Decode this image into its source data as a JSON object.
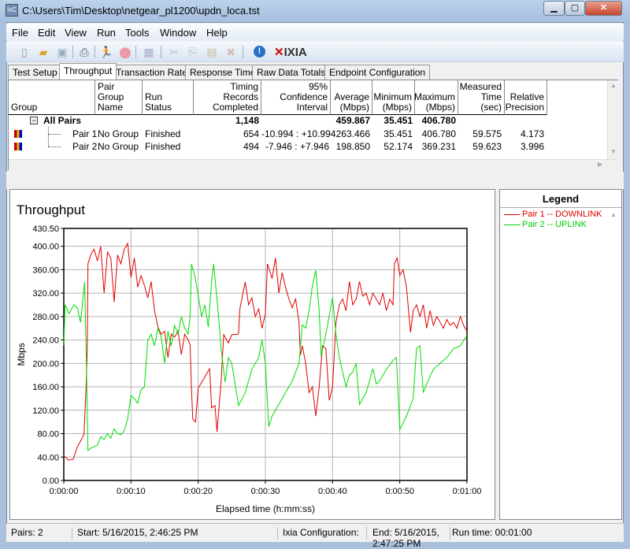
{
  "window": {
    "title": "C:\\Users\\Tim\\Desktop\\netgear_pl1200\\updn_loca.tst",
    "app_icon": "ixchariot-icon",
    "minimize": "minimize-icon",
    "maximize": "maximize-icon",
    "close": "close-icon"
  },
  "menu": [
    "File",
    "Edit",
    "View",
    "Run",
    "Tools",
    "Window",
    "Help"
  ],
  "toolbar": {
    "icons": [
      "new-file-icon",
      "open-folder-icon",
      "save-icon",
      "print-icon",
      "run-icon",
      "stop-icon",
      "refresh-icon",
      "cut-icon",
      "copy-icon",
      "paste-icon",
      "delete-icon",
      "info-icon"
    ],
    "brand": "IXIA"
  },
  "tabs": [
    "Test Setup",
    "Throughput",
    "Transaction Rate",
    "Response Time",
    "Raw Data Totals",
    "Endpoint Configuration"
  ],
  "active_tab": "Throughput",
  "table": {
    "headers": [
      "Group",
      "Pair Group Name",
      "Run Status",
      "Timing Records Completed",
      "95% Confidence Interval",
      "Average (Mbps)",
      "Minimum (Mbps)",
      "Maximum (Mbps)",
      "Measured Time (sec)",
      "Relative Precision"
    ],
    "summary": {
      "label": "All Pairs",
      "records": "1,148",
      "average": "459.867",
      "minimum": "35.451",
      "maximum": "406.780"
    },
    "rows": [
      {
        "pair": "Pair 1",
        "group": "No Group",
        "status": "Finished",
        "records": "654",
        "ci": "-10.994 : +10.994",
        "average": "263.466",
        "minimum": "35.451",
        "maximum": "406.780",
        "time": "59.575",
        "precision": "4.173"
      },
      {
        "pair": "Pair 2",
        "group": "No Group",
        "status": "Finished",
        "records": "494",
        "ci": "-7.946 : +7.946",
        "average": "198.850",
        "minimum": "52.174",
        "maximum": "369.231",
        "time": "59.623",
        "precision": "3.996"
      }
    ]
  },
  "legend": {
    "title": "Legend",
    "items": [
      "Pair 1 -- DOWNLINK",
      "Pair 2 -- UPLINK"
    ]
  },
  "status": {
    "pairs": "Pairs: 2",
    "start": "Start: 5/16/2015, 2:46:25 PM",
    "config": "Ixia Configuration:",
    "end": "End: 5/16/2015, 2:47:25 PM",
    "runtime": "Run time: 00:01:00"
  },
  "chart_data": {
    "type": "line",
    "title": "Throughput",
    "xlabel": "Elapsed time (h:mm:ss)",
    "ylabel": "Mbps",
    "ylim": [
      0,
      430.5
    ],
    "xlim": [
      0,
      60
    ],
    "grid": true,
    "legend_placement": "right-panel",
    "yticks": [
      "0.00",
      "40.00",
      "80.00",
      "120.00",
      "160.00",
      "200.00",
      "240.00",
      "280.00",
      "320.00",
      "360.00",
      "400.00",
      "430.50"
    ],
    "ytick_values": [
      0,
      40,
      80,
      120,
      160,
      200,
      240,
      280,
      320,
      360,
      400,
      430.5
    ],
    "xticks": [
      "0:00:00",
      "0:00:10",
      "0:00:20",
      "0:00:30",
      "0:00:40",
      "0:00:50",
      "0:01:00"
    ],
    "xtick_values": [
      0,
      10,
      20,
      30,
      40,
      50,
      60
    ],
    "series": [
      {
        "name": "Pair 1 -- DOWNLINK",
        "color": "#e00000",
        "points": [
          [
            0,
            42
          ],
          [
            0.7,
            35
          ],
          [
            1.4,
            36
          ],
          [
            2,
            57
          ],
          [
            3,
            78
          ],
          [
            3.3,
            155
          ],
          [
            3.5,
            231
          ],
          [
            3.6,
            370
          ],
          [
            4,
            385
          ],
          [
            4.5,
            395
          ],
          [
            5,
            375
          ],
          [
            5.5,
            400
          ],
          [
            6,
            320
          ],
          [
            6.5,
            390
          ],
          [
            7,
            380
          ],
          [
            7.5,
            305
          ],
          [
            8,
            385
          ],
          [
            8.5,
            370
          ],
          [
            9,
            395
          ],
          [
            9.5,
            405
          ],
          [
            10,
            347
          ],
          [
            10.5,
            380
          ],
          [
            11,
            330
          ],
          [
            11.5,
            350
          ],
          [
            12,
            333
          ],
          [
            12.5,
            312
          ],
          [
            13,
            340
          ],
          [
            13.5,
            290
          ],
          [
            14,
            262
          ],
          [
            14.5,
            250
          ],
          [
            15,
            255
          ],
          [
            15.5,
            210
          ],
          [
            16,
            250
          ],
          [
            16.5,
            245
          ],
          [
            17,
            255
          ],
          [
            17.5,
            215
          ],
          [
            18,
            250
          ],
          [
            18.5,
            240
          ],
          [
            18.8,
            232
          ],
          [
            19,
            158
          ],
          [
            19.2,
            105
          ],
          [
            19.6,
            100
          ],
          [
            20,
            158
          ],
          [
            21,
            177
          ],
          [
            21.7,
            191
          ],
          [
            22,
            124
          ],
          [
            22.5,
            128
          ],
          [
            22.8,
            83
          ],
          [
            23.4,
            168
          ],
          [
            23.8,
            249
          ],
          [
            24.5,
            235
          ],
          [
            25,
            249
          ],
          [
            26,
            250
          ],
          [
            26.2,
            293
          ],
          [
            27,
            339
          ],
          [
            27.5,
            300
          ],
          [
            28,
            312
          ],
          [
            28.5,
            280
          ],
          [
            29,
            293
          ],
          [
            29.5,
            260
          ],
          [
            30,
            285
          ],
          [
            30.3,
            370
          ],
          [
            31,
            345
          ],
          [
            31.5,
            380
          ],
          [
            32,
            320
          ],
          [
            32.5,
            355
          ],
          [
            33,
            330
          ],
          [
            33.5,
            310
          ],
          [
            34,
            295
          ],
          [
            34.5,
            310
          ],
          [
            35,
            270
          ],
          [
            35.2,
            214
          ],
          [
            35.5,
            230
          ],
          [
            36,
            200
          ],
          [
            36.5,
            150
          ],
          [
            37,
            160
          ],
          [
            37.5,
            110
          ],
          [
            38,
            160
          ],
          [
            38.5,
            230
          ],
          [
            39,
            225
          ],
          [
            39.5,
            137
          ],
          [
            40,
            160
          ],
          [
            40.5,
            270
          ],
          [
            41,
            300
          ],
          [
            41.5,
            310
          ],
          [
            42,
            290
          ],
          [
            42.5,
            340
          ],
          [
            43,
            300
          ],
          [
            43.5,
            310
          ],
          [
            44,
            340
          ],
          [
            44.5,
            315
          ],
          [
            45,
            320
          ],
          [
            45.5,
            300
          ],
          [
            46,
            320
          ],
          [
            46.5,
            310
          ],
          [
            47,
            300
          ],
          [
            47.5,
            320
          ],
          [
            48,
            290
          ],
          [
            48.5,
            310
          ],
          [
            49,
            300
          ],
          [
            49.2,
            370
          ],
          [
            49.6,
            380
          ],
          [
            50,
            350
          ],
          [
            50.5,
            360
          ],
          [
            51,
            330
          ],
          [
            51.6,
            253
          ],
          [
            52,
            290
          ],
          [
            52.5,
            300
          ],
          [
            53,
            280
          ],
          [
            53.5,
            300
          ],
          [
            54,
            260
          ],
          [
            54.5,
            290
          ],
          [
            55,
            265
          ],
          [
            55.5,
            280
          ],
          [
            56,
            270
          ],
          [
            56.5,
            260
          ],
          [
            57,
            275
          ],
          [
            57.5,
            265
          ],
          [
            58,
            270
          ],
          [
            58.5,
            260
          ],
          [
            59,
            280
          ],
          [
            59.5,
            265
          ],
          [
            60,
            255
          ]
        ]
      },
      {
        "name": "Pair 2 -- UPLINK",
        "color": "#00dd00",
        "points": [
          [
            0,
            231
          ],
          [
            0.2,
            300
          ],
          [
            0.8,
            285
          ],
          [
            1.5,
            300
          ],
          [
            2,
            295
          ],
          [
            2.5,
            270
          ],
          [
            3.1,
            339
          ],
          [
            3.3,
            235
          ],
          [
            3.6,
            51
          ],
          [
            4,
            55
          ],
          [
            5,
            60
          ],
          [
            5.5,
            75
          ],
          [
            6,
            70
          ],
          [
            6.5,
            80
          ],
          [
            7,
            72
          ],
          [
            7.5,
            88
          ],
          [
            8,
            80
          ],
          [
            8.5,
            78
          ],
          [
            9,
            85
          ],
          [
            9.5,
            105
          ],
          [
            10,
            145
          ],
          [
            10.5,
            140
          ],
          [
            11,
            132
          ],
          [
            11.5,
            155
          ],
          [
            12,
            160
          ],
          [
            12.5,
            240
          ],
          [
            13,
            250
          ],
          [
            13.5,
            230
          ],
          [
            14,
            260
          ],
          [
            14.5,
            245
          ],
          [
            15,
            200
          ],
          [
            15.5,
            255
          ],
          [
            16,
            230
          ],
          [
            16.5,
            265
          ],
          [
            17,
            250
          ],
          [
            17.5,
            280
          ],
          [
            18,
            260
          ],
          [
            18.5,
            250
          ],
          [
            18.8,
            280
          ],
          [
            19,
            370
          ],
          [
            19.5,
            350
          ],
          [
            20,
            316
          ],
          [
            20.5,
            280
          ],
          [
            21,
            300
          ],
          [
            21.5,
            262
          ],
          [
            22,
            340
          ],
          [
            22.3,
            370
          ],
          [
            23,
            284
          ],
          [
            23.4,
            226
          ],
          [
            24,
            168
          ],
          [
            24.5,
            210
          ],
          [
            25,
            200
          ],
          [
            26,
            128
          ],
          [
            27,
            150
          ],
          [
            28,
            190
          ],
          [
            28.5,
            200
          ],
          [
            29,
            210
          ],
          [
            29.5,
            240
          ],
          [
            30,
            200
          ],
          [
            30.5,
            92
          ],
          [
            31,
            110
          ],
          [
            32,
            130
          ],
          [
            33,
            150
          ],
          [
            34,
            170
          ],
          [
            35,
            200
          ],
          [
            35.5,
            266
          ],
          [
            36,
            260
          ],
          [
            36.5,
            290
          ],
          [
            37,
            333
          ],
          [
            37.5,
            359
          ],
          [
            38,
            290
          ],
          [
            38.3,
            213
          ],
          [
            39,
            250
          ],
          [
            40,
            312
          ],
          [
            40.5,
            250
          ],
          [
            41,
            210
          ],
          [
            42,
            160
          ],
          [
            42.5,
            180
          ],
          [
            43,
            185
          ],
          [
            43.5,
            200
          ],
          [
            44,
            130
          ],
          [
            44.5,
            140
          ],
          [
            45,
            150
          ],
          [
            46,
            191
          ],
          [
            46.5,
            165
          ],
          [
            47,
            170
          ],
          [
            48,
            190
          ],
          [
            49,
            205
          ],
          [
            49.5,
            210
          ],
          [
            50,
            87
          ],
          [
            51,
            110
          ],
          [
            52,
            140
          ],
          [
            52.5,
            226
          ],
          [
            53,
            230
          ],
          [
            53.5,
            150
          ],
          [
            54,
            165
          ],
          [
            55,
            190
          ],
          [
            56,
            200
          ],
          [
            57,
            210
          ],
          [
            58,
            225
          ],
          [
            59,
            230
          ],
          [
            60,
            248
          ]
        ]
      }
    ]
  }
}
